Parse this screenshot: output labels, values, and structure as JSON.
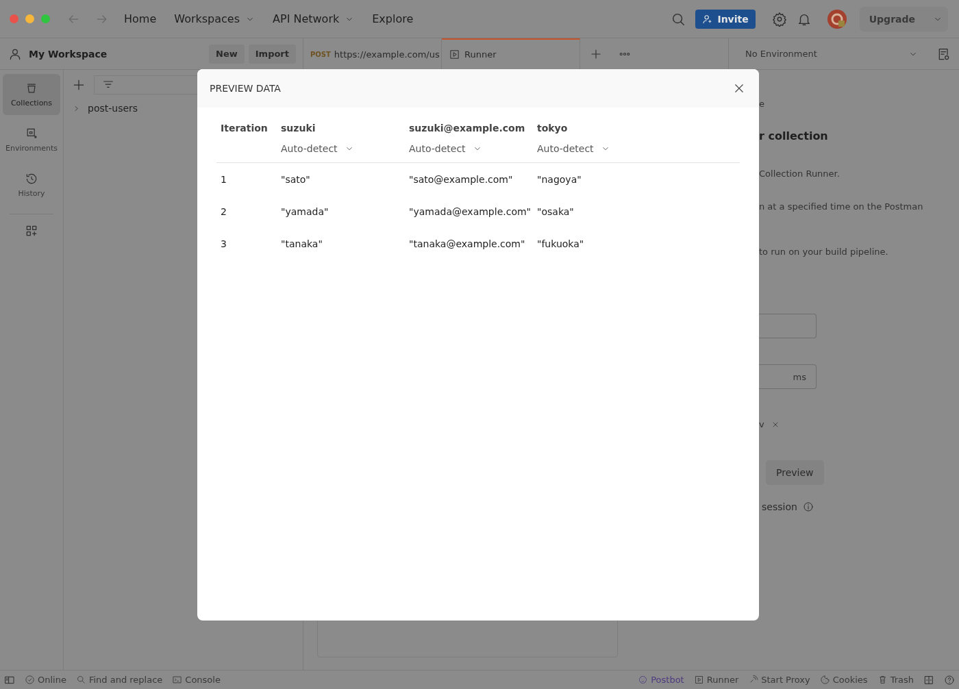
{
  "title_bar": {
    "nav": [
      {
        "label": "Home",
        "dropdown": false
      },
      {
        "label": "Workspaces",
        "dropdown": true
      },
      {
        "label": "API Network",
        "dropdown": true
      },
      {
        "label": "Explore",
        "dropdown": false
      }
    ],
    "invite": "Invite",
    "upgrade": "Upgrade"
  },
  "workspace": {
    "name": "My Workspace",
    "buttons": [
      "New",
      "Import"
    ]
  },
  "tabs": [
    {
      "method": "POST",
      "label": "https://example.com/us",
      "selected": false
    },
    {
      "label": "Runner",
      "selected": true
    }
  ],
  "environment": "No Environment",
  "nav_rail": [
    {
      "label": "Collections",
      "selected": true
    },
    {
      "label": "Environments",
      "selected": false
    },
    {
      "label": "History",
      "selected": false
    }
  ],
  "collections": [
    {
      "name": "post-users",
      "expanded": false
    }
  ],
  "runner_panel": {
    "line_1": "e",
    "heading": "r collection",
    "line_2": "Collection Runner.",
    "line_3": "n at a specified time on the Postman",
    "line_4": "to run on your build pipeline.",
    "delay_unit": "ms",
    "file_name": "v",
    "preview_button": "Preview",
    "session_label": "session"
  },
  "modal": {
    "title": "PREVIEW DATA",
    "columns": [
      {
        "name": "Iteration"
      },
      {
        "name": "suzuki",
        "type": "Auto-detect"
      },
      {
        "name": "suzuki@example.com",
        "type": "Auto-detect"
      },
      {
        "name": "tokyo",
        "type": "Auto-detect"
      }
    ],
    "rows": [
      [
        "1",
        "\"sato\"",
        "\"sato@example.com\"",
        "\"nagoya\""
      ],
      [
        "2",
        "\"yamada\"",
        "\"yamada@example.com\"",
        "\"osaka\""
      ],
      [
        "3",
        "\"tanaka\"",
        "\"tanaka@example.com\"",
        "\"fukuoka\""
      ]
    ]
  },
  "status_bar": {
    "left": [
      "Online",
      "Find and replace",
      "Console"
    ],
    "right": [
      {
        "label": "Postbot",
        "color": "#4f3b80"
      },
      {
        "label": "Runner",
        "color": "#3a3a3a"
      },
      {
        "label": "Start Proxy",
        "color": "#3a3a3a"
      },
      {
        "label": "Cookies",
        "color": "#3a3a3a"
      },
      {
        "label": "Trash",
        "color": "#3a3a3a"
      }
    ]
  }
}
